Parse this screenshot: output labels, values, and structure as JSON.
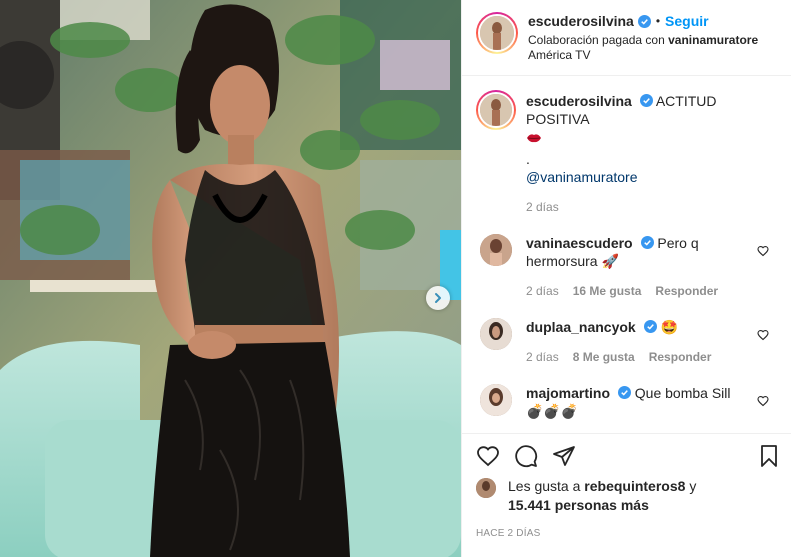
{
  "post": {
    "username": "escuderosilvina",
    "separator": "•",
    "follow_label": "Seguir",
    "paid_label": "Colaboración pagada con",
    "partner": "vaninamuratore",
    "location": "América TV"
  },
  "caption": {
    "username": "escuderosilvina",
    "text": "ACTITUD POSITIVA",
    "emoji": "kiss-mark-emoji",
    "dot": ".",
    "mention": "@vaninamuratore",
    "time": "2 días"
  },
  "comments": [
    {
      "username": "vaninaescudero",
      "text": "Pero q hermorsura 🚀",
      "time": "2 días",
      "likes": "16 Me gusta",
      "reply": "Responder"
    },
    {
      "username": "duplaa_nancyok",
      "text": "🤩",
      "time": "2 días",
      "likes": "8 Me gusta",
      "reply": "Responder"
    },
    {
      "username": "majomartino",
      "text": "Que bomba Sill",
      "emoji_line": "💣💣💣"
    }
  ],
  "likes": {
    "prefix": "Les gusta a",
    "user": "rebequinteros8",
    "and": "y",
    "count": "15.441 personas más"
  },
  "timestamp": "HACE 2 DÍAS",
  "colors": {
    "accent": "#0095f6",
    "verified": "#3897f0",
    "muted": "#8e8e8e"
  }
}
